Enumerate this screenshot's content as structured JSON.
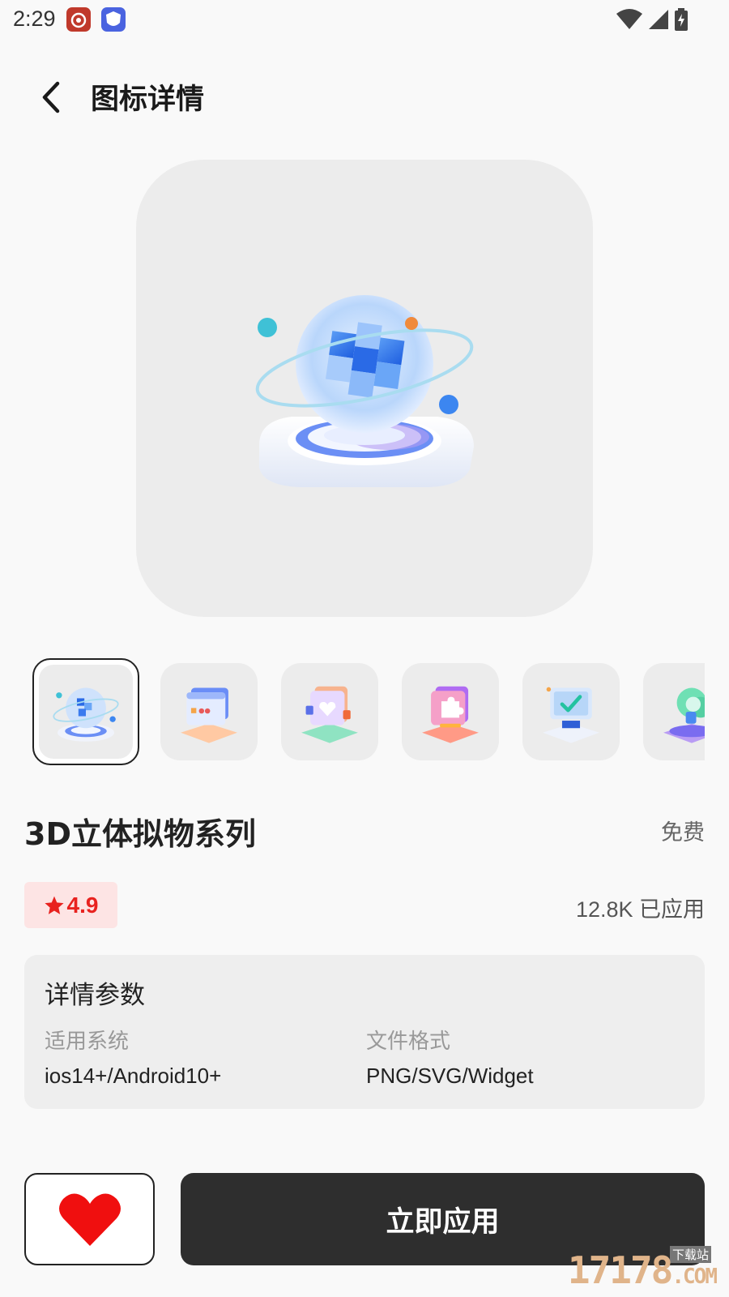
{
  "status_bar": {
    "time": "2:29",
    "notifications": [
      "weibo-icon",
      "shield-app-icon"
    ],
    "system": [
      "wifi-icon",
      "signal-icon",
      "battery-charging-icon"
    ]
  },
  "header": {
    "back_icon": "chevron-left-icon",
    "title": "图标详情"
  },
  "hero": {
    "icon": "glass-globe-3d-icon"
  },
  "thumbnails": [
    {
      "icon": "glass-globe-3d-icon",
      "selected": true
    },
    {
      "icon": "browser-window-3d-icon",
      "selected": false
    },
    {
      "icon": "wallet-heart-3d-icon",
      "selected": false
    },
    {
      "icon": "puzzle-3d-icon",
      "selected": false
    },
    {
      "icon": "monitor-check-3d-icon",
      "selected": false
    },
    {
      "icon": "cloud-3d-icon",
      "selected": false
    }
  ],
  "series": {
    "title": "3D立体拟物系列",
    "price": "免费"
  },
  "stats": {
    "rating": "4.9",
    "applied": "12.8K 已应用"
  },
  "details": {
    "title": "详情参数",
    "params": [
      {
        "label": "适用系统",
        "value": "ios14+/Android10+"
      },
      {
        "label": "文件格式",
        "value": "PNG/SVG/Widget"
      }
    ]
  },
  "actions": {
    "favorite_icon": "heart-icon",
    "apply_label": "立即应用"
  },
  "watermark": {
    "text": "17178",
    "suffix": ".COM",
    "badge": "下载站"
  },
  "colors": {
    "accent_red": "#e8221f",
    "rating_bg": "#fde4e4",
    "button_dark": "#2e2e2e",
    "card_bg": "#ececec"
  }
}
